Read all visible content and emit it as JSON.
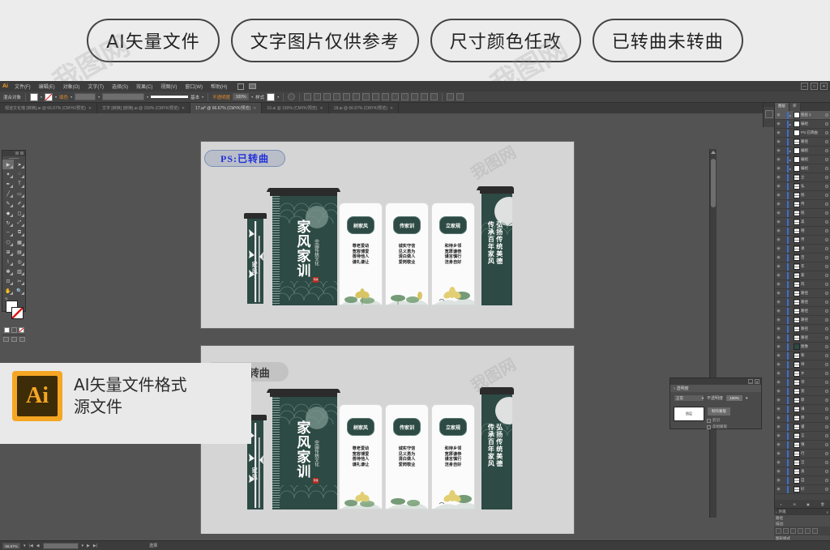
{
  "promo": {
    "pills": [
      "AI矢量文件",
      "文字图片仅供参考",
      "尺寸颜色任改",
      "已转曲未转曲"
    ],
    "watermark": "我图网"
  },
  "app": {
    "name": "Ai",
    "menus": [
      "文件(F)",
      "编辑(E)",
      "对象(O)",
      "文字(T)",
      "选择(S)",
      "效果(C)",
      "视图(V)",
      "窗口(W)",
      "帮助(H)"
    ],
    "window_buttons": [
      "—",
      "□",
      "✕"
    ]
  },
  "control_bar": {
    "object_label": "混合对象",
    "fill_label": "填色",
    "stroke_label": "描边",
    "stroke_profile": "基本",
    "opacity_label": "不透明度",
    "opacity_value": "100%",
    "style_label": "样式",
    "stroke_weight": "1 pt"
  },
  "doc_tabs": [
    {
      "name": "观道文化墙 [转换].ai @ 66.67% (CMYK/预览)",
      "active": false
    },
    {
      "name": "文字 [转换] [转换].ai @ 150% (CMYK/预览)",
      "active": false
    },
    {
      "name": "17.ai* @ 66.67% (CMYK/预览)",
      "active": true
    },
    {
      "name": "16.ai @ 150% (CMYK/预览)",
      "active": false
    },
    {
      "name": "18.ai @ 66.67% (CMYK/预览)",
      "active": false
    }
  ],
  "toolbox": {
    "tools": [
      "selection-tool",
      "direct-selection-tool",
      "magic-wand-tool",
      "lasso-tool",
      "pen-tool",
      "type-tool",
      "line-tool",
      "rectangle-tool",
      "paintbrush-tool",
      "pencil-tool",
      "shaper-tool",
      "eraser-tool",
      "rotate-tool",
      "scale-tool",
      "width-tool",
      "free-transform-tool",
      "shape-builder-tool",
      "perspective-grid-tool",
      "mesh-tool",
      "gradient-tool",
      "eyedropper-tool",
      "blend-tool",
      "symbol-sprayer-tool",
      "column-graph-tool",
      "artboard-tool",
      "slice-tool",
      "hand-tool",
      "zoom-tool"
    ]
  },
  "artboards": [
    {
      "id": "top",
      "badge": "PS:已转曲",
      "badge_state": "selected",
      "artwork": {
        "main_title": "家风家训",
        "subtitle": "中国传统文化",
        "seal": "传统",
        "bamboo_caption": "家风",
        "panels": [
          {
            "badge": "树家风",
            "lines": "尊老爱幼\n宽容博爱\n善待他人\n谦礼谦让"
          },
          {
            "badge": "传家训",
            "lines": "诚实守信\n见义勇为\n清白做人\n爱岗敬业"
          },
          {
            "badge": "立家规",
            "lines": "和待乡邻\n宽厚谦恭\n谨言慎行\n洁身自好"
          }
        ],
        "right_slogan": "弘扬传统美德\n传承百年家风"
      }
    },
    {
      "id": "bottom",
      "badge": "PS:未转曲",
      "badge_state": "plain",
      "artwork": {
        "main_title": "家风家训",
        "subtitle": "中国传统文化",
        "seal": "传统",
        "bamboo_caption": "家风",
        "panels": [
          {
            "badge": "树家风",
            "lines": "尊老爱幼\n宽容博爱\n善待他人\n谦礼谦让"
          },
          {
            "badge": "传家训",
            "lines": "诚实守信\n见义勇为\n清白做人\n爱岗敬业"
          },
          {
            "badge": "立家规",
            "lines": "和待乡邻\n宽厚谦恭\n谨言慎行\n洁身自好"
          }
        ],
        "right_slogan": "弘扬传统美德\n传承百年家风"
      }
    }
  ],
  "layers_panel": {
    "tabs": [
      "图层",
      "库"
    ],
    "rows": [
      {
        "name": "图层 1",
        "type": "layer",
        "selected": true
      },
      {
        "name": "编组",
        "type": "group"
      },
      {
        "name": "PS:已转曲",
        "type": "text"
      },
      {
        "name": "路径",
        "type": "path"
      },
      {
        "name": "编组",
        "type": "group"
      },
      {
        "name": "编组",
        "type": "group"
      },
      {
        "name": "编组",
        "type": "group"
      },
      {
        "name": "立",
        "type": "path"
      },
      {
        "name": "弘",
        "type": "path"
      },
      {
        "name": "扬",
        "type": "path"
      },
      {
        "name": "传",
        "type": "path"
      },
      {
        "name": "统",
        "type": "path"
      },
      {
        "name": "美",
        "type": "path"
      },
      {
        "name": "德",
        "type": "path"
      },
      {
        "name": "传",
        "type": "path"
      },
      {
        "name": "承",
        "type": "path"
      },
      {
        "name": "百",
        "type": "path"
      },
      {
        "name": "年",
        "type": "path"
      },
      {
        "name": "家",
        "type": "path"
      },
      {
        "name": "风",
        "type": "path"
      },
      {
        "name": "路径",
        "type": "path"
      },
      {
        "name": "路径",
        "type": "path"
      },
      {
        "name": "路径",
        "type": "path"
      },
      {
        "name": "路径",
        "type": "path"
      },
      {
        "name": "路径",
        "type": "path"
      },
      {
        "name": "路径",
        "type": "path"
      },
      {
        "name": "图像",
        "type": "image"
      },
      {
        "name": "和",
        "type": "path"
      },
      {
        "name": "待",
        "type": "path"
      },
      {
        "name": "乡",
        "type": "path"
      },
      {
        "name": "邻",
        "type": "path"
      },
      {
        "name": "宽",
        "type": "path"
      },
      {
        "name": "厚",
        "type": "path"
      },
      {
        "name": "谦",
        "type": "path"
      },
      {
        "name": "恭",
        "type": "path"
      },
      {
        "name": "谨",
        "type": "path"
      },
      {
        "name": "言",
        "type": "path"
      },
      {
        "name": "慎",
        "type": "path"
      },
      {
        "name": "行",
        "type": "path"
      },
      {
        "name": "洁",
        "type": "path"
      },
      {
        "name": "身",
        "type": "path"
      },
      {
        "name": "自",
        "type": "path"
      },
      {
        "name": "好",
        "type": "path"
      }
    ],
    "footer_icons": [
      "make-clipping-mask-icon",
      "make-sublayer-icon",
      "new-layer-icon",
      "delete-layer-icon"
    ]
  },
  "transparency_panel": {
    "title": "透明度",
    "blend_mode": "正常",
    "opacity_label": "不透明度",
    "opacity_value": "100%",
    "make_mask_button": "制作蒙版",
    "clip_label": "剪切",
    "invert_label": "反相蒙版",
    "thumb_label": "图层"
  },
  "appearance_panel": {
    "title": "外观",
    "section": "路径",
    "subtitle_stroke": "描边:",
    "subtitle_fill": "填色:",
    "graphic_styles": "图形样式"
  },
  "status_bar": {
    "zoom": "66.67%",
    "tool_status": "选择",
    "artboard_nav": "1"
  },
  "ai_badge": {
    "icon_text": "Ai",
    "line1": "AI矢量文件格式",
    "line2": "源文件"
  },
  "colors": {
    "accent_green": "#2d4a44",
    "roof_dark": "#2b2b2b",
    "seal_red": "#b42b1f",
    "artboard_bg": "#d5d5d5",
    "ui_bg": "#535353",
    "ai_orange": "#f5a623",
    "selection_blue": "#2030d8"
  }
}
